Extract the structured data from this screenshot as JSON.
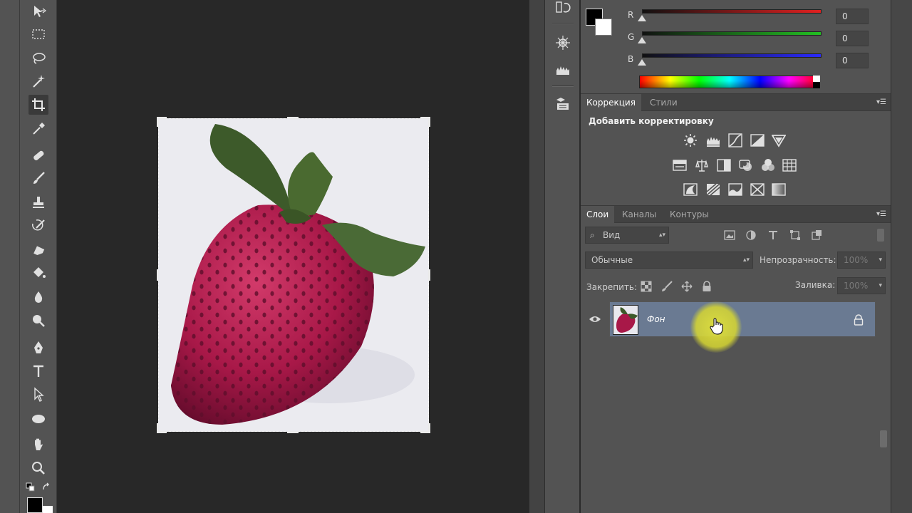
{
  "color_panel": {
    "channels": [
      {
        "label": "R",
        "value": "0",
        "color": "#e02020"
      },
      {
        "label": "G",
        "value": "0",
        "color": "#22c022"
      },
      {
        "label": "B",
        "value": "0",
        "color": "#2a2aff"
      }
    ]
  },
  "adjustments": {
    "tabs": [
      "Коррекция",
      "Стили"
    ],
    "title": "Добавить корректировку",
    "row1": [
      "brightness-contrast-icon",
      "levels-icon",
      "curves-icon",
      "exposure-icon",
      "vibrance-icon"
    ],
    "row2": [
      "hue-saturation-icon",
      "color-balance-icon",
      "black-white-icon",
      "photo-filter-icon",
      "channel-mixer-icon",
      "color-lookup-icon"
    ],
    "row3": [
      "invert-icon",
      "posterize-icon",
      "threshold-icon",
      "selective-color-icon",
      "gradient-map-icon"
    ]
  },
  "layers": {
    "tabs": [
      "Слои",
      "Каналы",
      "Контуры"
    ],
    "filter_label": "Вид",
    "blend_mode": "Обычные",
    "opacity_label": "Непрозрачность:",
    "opacity_value": "100%",
    "lock_label": "Закрепить:",
    "fill_label": "Заливка:",
    "fill_value": "100%",
    "layer_name": "Фон"
  },
  "colors": {
    "panel_bg": "#535353",
    "canvas_bg": "#282828",
    "layer_selected": "#6a7a92",
    "cursor_highlight": "#dcdc3c"
  }
}
